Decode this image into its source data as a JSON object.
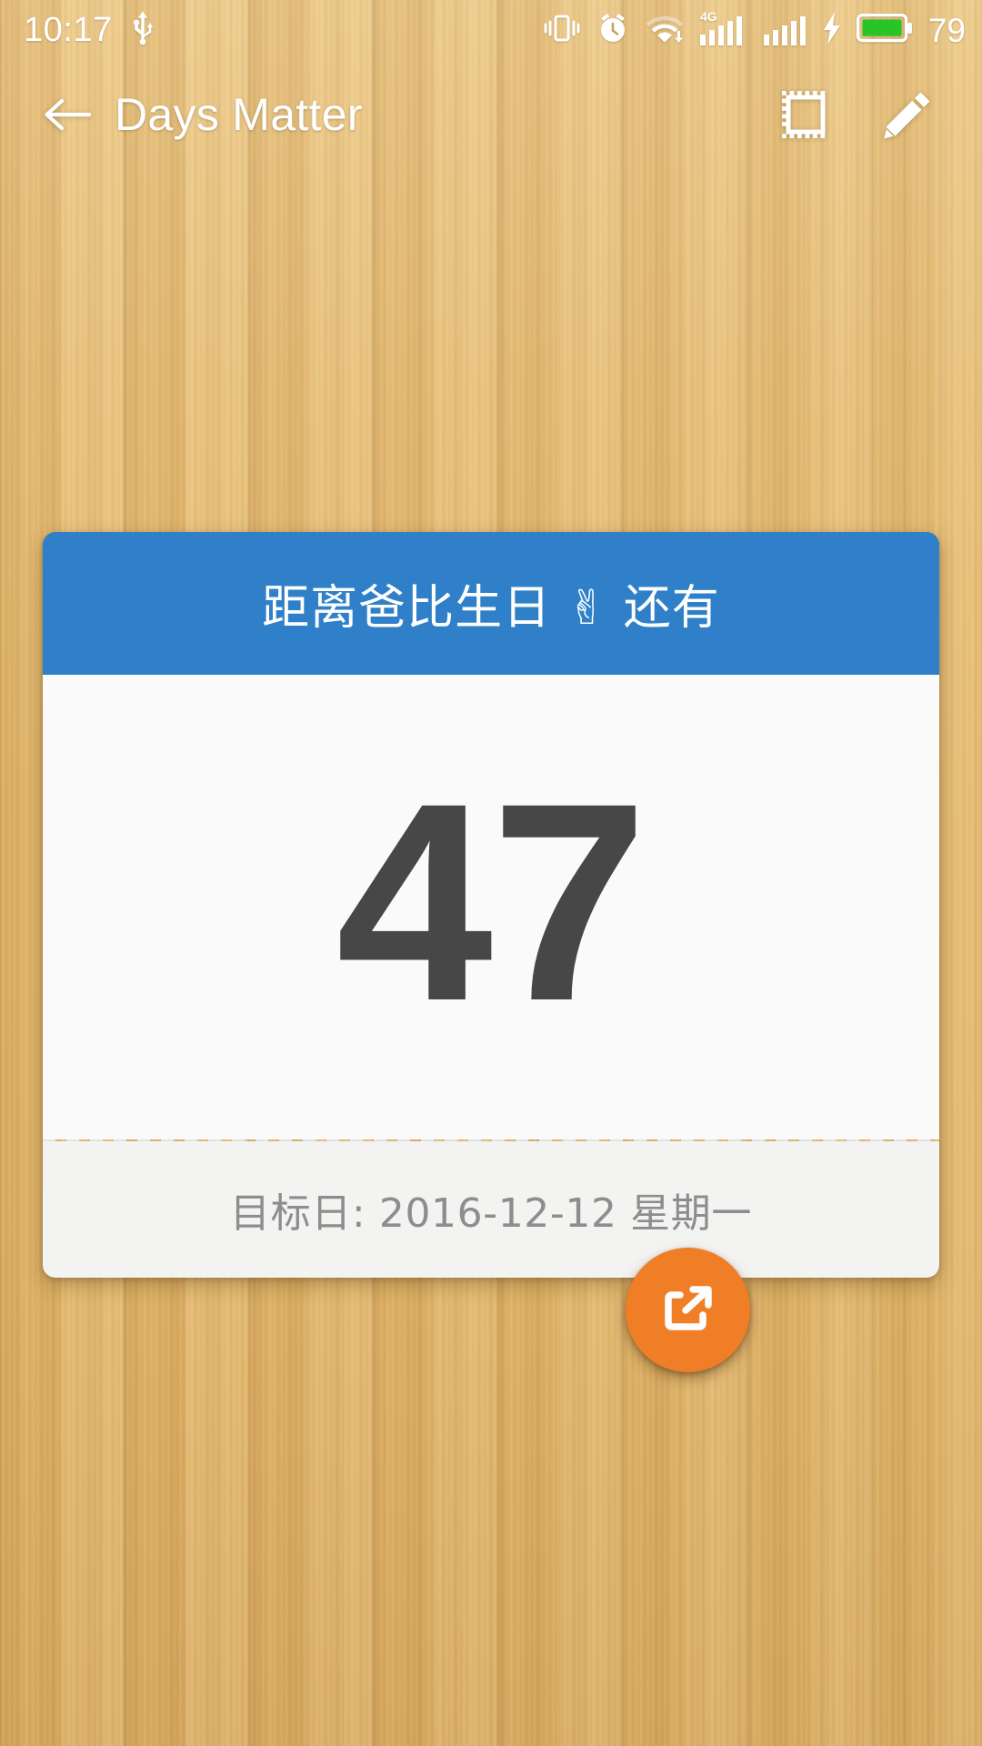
{
  "status_bar": {
    "time": "10:17",
    "battery_percent": "79",
    "icons": [
      "usb-icon",
      "vibrate-icon",
      "alarm-clock-icon",
      "wifi-download-icon",
      "signal-4g-icon",
      "signal-bars-icon",
      "charging-bolt-icon",
      "battery-icon"
    ],
    "network_label": "4G",
    "battery_color": "#29c426"
  },
  "app_bar": {
    "title": "Days Matter",
    "back_label": "back-arrow",
    "actions": [
      {
        "name": "stamp-frame",
        "label": "Stamp"
      },
      {
        "name": "edit-pencil",
        "label": "Edit"
      }
    ]
  },
  "card": {
    "header_title": "距离爸比生日 ✌ 还有",
    "header_color": "#2f80c8",
    "days_count": "47",
    "days_color": "#474747",
    "target_date_label": "目标日: 2016-12-12 星期一",
    "body_color": "#fafafa",
    "footer_color": "#f3f3f1"
  },
  "fab": {
    "label": "Share",
    "icon": "share-icon",
    "color": "#f07e26"
  }
}
